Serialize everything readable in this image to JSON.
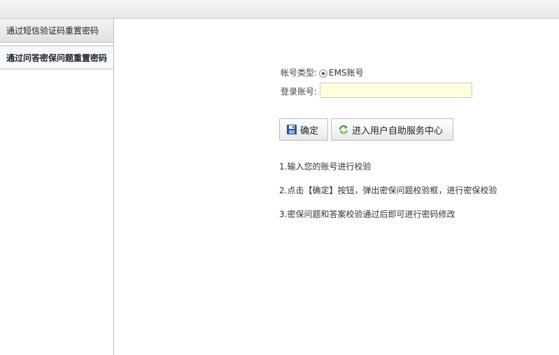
{
  "sidebar": {
    "tabs": [
      {
        "label": "通过短信验证码重置密码"
      },
      {
        "label": "通过问答密保问题重置密码"
      }
    ]
  },
  "form": {
    "account_type_label": "帐号类型:",
    "account_type_option": "EMS账号",
    "login_account_label": "登录账号:",
    "login_account_value": ""
  },
  "buttons": {
    "confirm": "确定",
    "self_service": "进入用户自助服务中心"
  },
  "tips": [
    "1.输入您的账号进行校验",
    "2.点击【确定】按钮，弹出密保问题校验框，进行密保校验",
    "3.密保问题和答案校验通过后即可进行密码修改"
  ]
}
